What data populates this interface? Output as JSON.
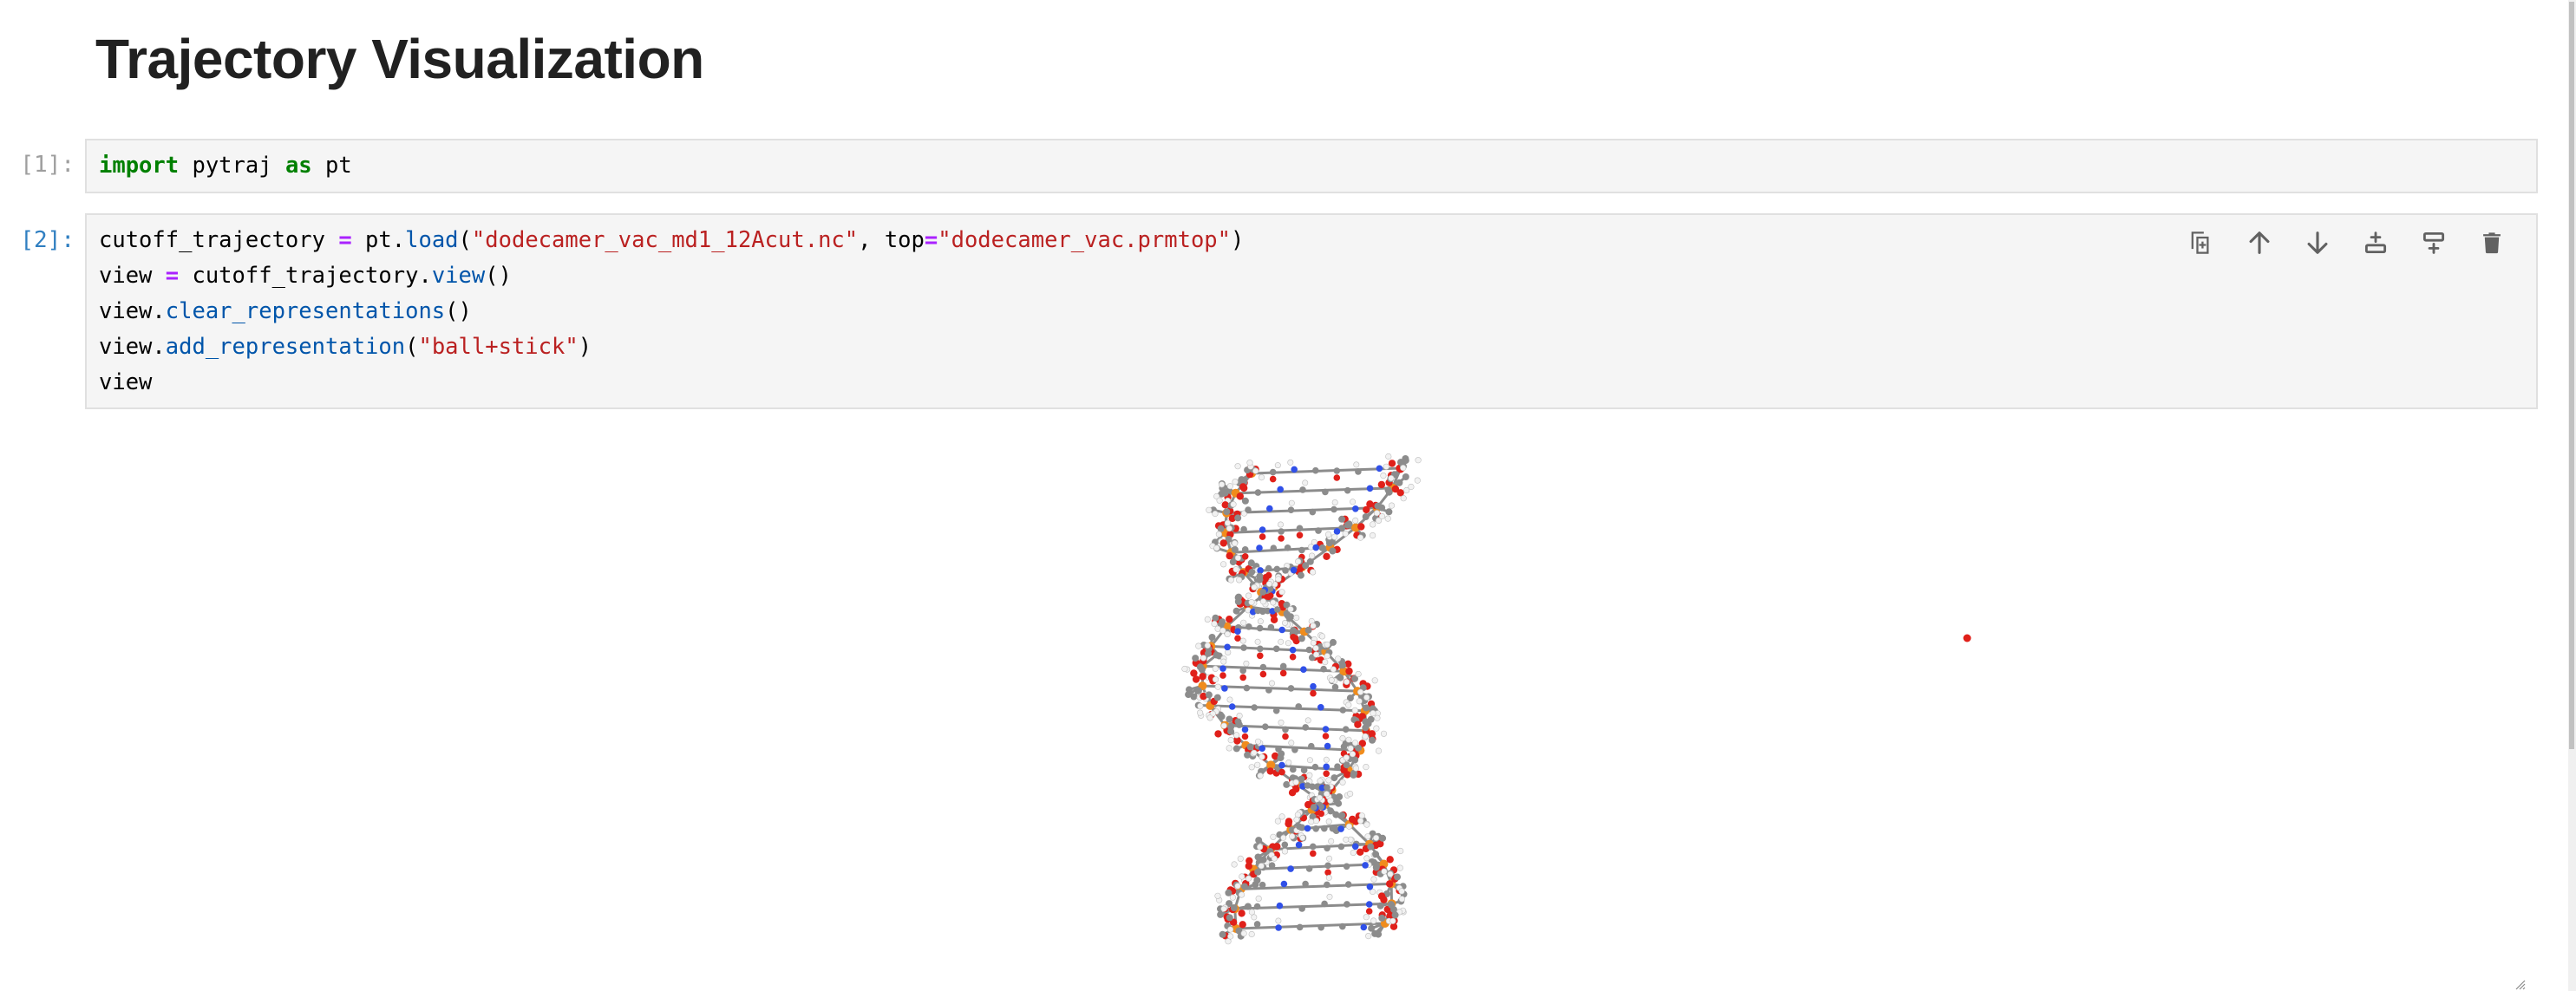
{
  "notebook": {
    "heading": "Trajectory Visualization",
    "cells": [
      {
        "prompt": "[1]:",
        "lines": [
          [
            {
              "t": "import",
              "c": "kw"
            },
            {
              "t": " pytraj ",
              "c": ""
            },
            {
              "t": "as",
              "c": "kw"
            },
            {
              "t": " pt",
              "c": ""
            }
          ]
        ]
      },
      {
        "prompt": "[2]:",
        "lines": [
          [
            {
              "t": "cutoff_trajectory ",
              "c": ""
            },
            {
              "t": "=",
              "c": "op"
            },
            {
              "t": " pt.",
              "c": ""
            },
            {
              "t": "load",
              "c": "fn"
            },
            {
              "t": "(",
              "c": ""
            },
            {
              "t": "\"dodecamer_vac_md1_12Acut.nc\"",
              "c": "str"
            },
            {
              "t": ", top",
              "c": ""
            },
            {
              "t": "=",
              "c": "op"
            },
            {
              "t": "\"dodecamer_vac.prmtop\"",
              "c": "str"
            },
            {
              "t": ")",
              "c": ""
            }
          ],
          [
            {
              "t": "view ",
              "c": ""
            },
            {
              "t": "=",
              "c": "op"
            },
            {
              "t": " cutoff_trajectory.",
              "c": ""
            },
            {
              "t": "view",
              "c": "fn"
            },
            {
              "t": "()",
              "c": ""
            }
          ],
          [
            {
              "t": "view.",
              "c": ""
            },
            {
              "t": "clear_representations",
              "c": "fn"
            },
            {
              "t": "()",
              "c": ""
            }
          ],
          [
            {
              "t": "view.",
              "c": ""
            },
            {
              "t": "add_representation",
              "c": "fn"
            },
            {
              "t": "(",
              "c": ""
            },
            {
              "t": "\"ball+stick\"",
              "c": "str"
            },
            {
              "t": ")",
              "c": ""
            }
          ],
          [
            {
              "t": "view",
              "c": ""
            }
          ]
        ]
      }
    ],
    "cell_toolbar": [
      {
        "name": "duplicate-cell-icon",
        "label": "Duplicate cell"
      },
      {
        "name": "move-up-icon",
        "label": "Move up"
      },
      {
        "name": "move-down-icon",
        "label": "Move down"
      },
      {
        "name": "insert-above-icon",
        "label": "Insert cell above"
      },
      {
        "name": "insert-below-icon",
        "label": "Insert cell below"
      },
      {
        "name": "delete-icon",
        "label": "Delete cell"
      }
    ],
    "viewer": {
      "representation": "ball+stick",
      "atom_colors": {
        "carbon": "#8c8c8c",
        "oxygen": "#e0201a",
        "nitrogen": "#3050e8",
        "phosphorus": "#f08c1c",
        "hydrogen": "#f2f2f2"
      }
    },
    "colors": {
      "cell_bg": "#f5f5f5",
      "cell_border": "#e0e0e0",
      "prompt_inactive": "#9e9e9e",
      "prompt_active": "#307fc1",
      "icon": "#616161"
    }
  }
}
